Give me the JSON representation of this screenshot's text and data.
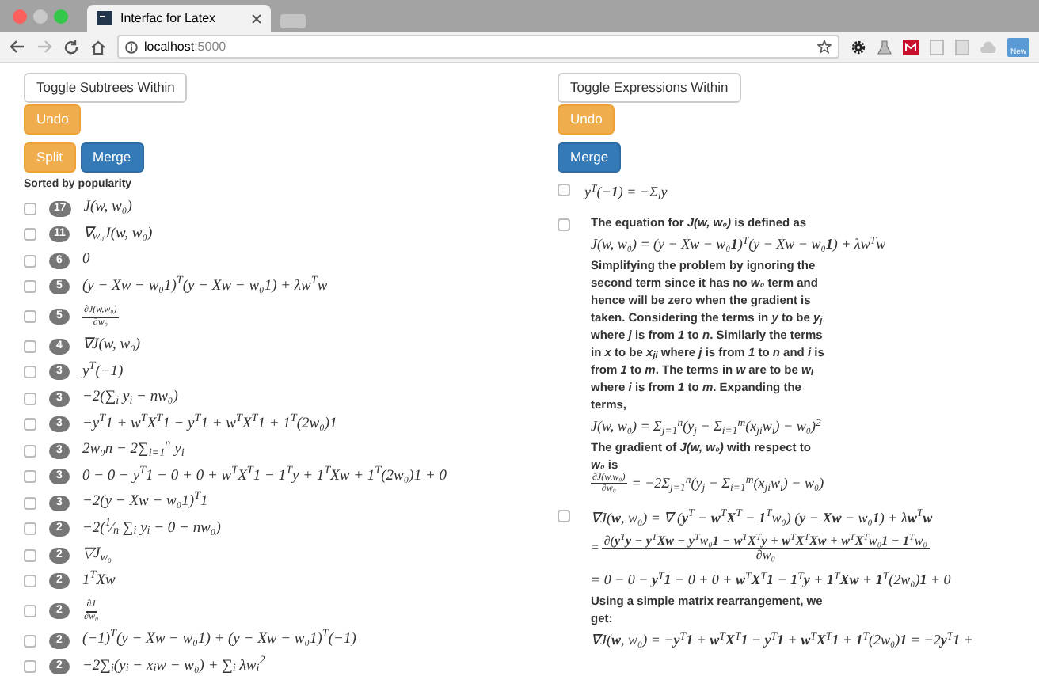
{
  "browser": {
    "tab_title": "Interfac for Latex",
    "url_host": "localhost",
    "url_port": ":5000",
    "extension_badge": "New"
  },
  "left": {
    "buttons": [
      {
        "label": "Toggle Subtrees Within",
        "kind": "default"
      },
      {
        "label": "Undo",
        "kind": "warning"
      },
      {
        "label": "Split",
        "kind": "warning"
      },
      {
        "label": "Merge",
        "kind": "primary"
      }
    ],
    "heading": "Sorted by popularity",
    "items": [
      {
        "checked": false,
        "count": "17",
        "kind": "math",
        "expr": "J(w, w₀)"
      },
      {
        "checked": false,
        "count": "11",
        "kind": "math",
        "expr": "∇$_{w₀}$J(w, w₀)"
      },
      {
        "checked": false,
        "count": "6",
        "kind": "math",
        "expr": "0"
      },
      {
        "checked": false,
        "count": "5",
        "kind": "math",
        "expr": "(y − Xw − w₀1)$^{T}$(y − Xw − w₀1) + λw$^{T}$w"
      },
      {
        "checked": false,
        "count": "5",
        "kind": "fraction",
        "num": "∂J(w,w₀)",
        "den": "∂w₀"
      },
      {
        "checked": false,
        "count": "4",
        "kind": "math",
        "expr": "∇J(w, w₀)"
      },
      {
        "checked": false,
        "count": "3",
        "kind": "math",
        "expr": "y$^{T}$(−1)"
      },
      {
        "checked": false,
        "count": "3",
        "kind": "math",
        "expr": "−2(∑$_{i}$ y$_{i}$ − nw₀)"
      },
      {
        "checked": false,
        "count": "3",
        "kind": "math",
        "expr": "−y$^{T}$1 + w$^{T}$X$^{T}$1 − y$^{T}$1 + w$^{T}$X$^{T}$1 + 1$^{T}$(2w₀)1"
      },
      {
        "checked": false,
        "count": "3",
        "kind": "math",
        "expr": "2w₀n − 2∑$_{i=1}$$^{n}$ y$_{i}$"
      },
      {
        "checked": false,
        "count": "3",
        "kind": "math",
        "expr": "0 − 0 − y$^{T}$1 − 0 + 0 + w$^{T}$X$^{T}$1 − 1$^{T}$y + 1$^{T}$Xw + 1$^{T}$(2w₀)1 + 0"
      },
      {
        "checked": false,
        "count": "3",
        "kind": "math",
        "expr": "−2(y − Xw − w₀1)$^{T}$1"
      },
      {
        "checked": false,
        "count": "2",
        "kind": "math",
        "expr": "−2($^{1}$⁄$_{n}$ ∑$_{i}$ y$_{i}$ − 0 − nw₀)"
      },
      {
        "checked": false,
        "count": "2",
        "kind": "math",
        "expr": "▽J$_{w₀}$"
      },
      {
        "checked": false,
        "count": "2",
        "kind": "math",
        "expr": "1$^{T}$Xw"
      },
      {
        "checked": false,
        "count": "2",
        "kind": "fraction",
        "num": "∂J",
        "den": "∂w₀"
      },
      {
        "checked": false,
        "count": "2",
        "kind": "math",
        "expr": "(−1)$^{T}$(y − Xw − w₀1) + (y − Xw − w₀1)$^{T}$(−1)"
      },
      {
        "checked": false,
        "count": "2",
        "kind": "math",
        "expr": "−2∑$_{i}$(y$_{i}$ − x$_{i}$w − w₀) + ∑$_{i}$ λw$_{i}$$^{2}$"
      }
    ]
  },
  "right": {
    "buttons": [
      {
        "label": "Toggle Expressions Within",
        "kind": "default"
      },
      {
        "label": "Undo",
        "kind": "warning"
      },
      {
        "label": "Merge",
        "kind": "primary"
      }
    ],
    "items": [
      {
        "checked": false,
        "lines": [
          {
            "kind": "math",
            "text": "y$^{T}$(−**1**) = −Σ$_{i}$y"
          }
        ]
      },
      {
        "checked": false,
        "lines": [
          {
            "kind": "text",
            "text": "The equation for *J(w, w₀)* is defined as"
          },
          {
            "kind": "math",
            "text": "J(w, w₀) = (y − Xw − w₀**1**)$^{T}$(y − Xw − w₀**1**) + λw$^{T}$w"
          },
          {
            "kind": "text",
            "text": "Simplifying the problem by ignoring the"
          },
          {
            "kind": "text",
            "text": "second term since it has no *w₀* term and"
          },
          {
            "kind": "text",
            "text": "hence will be zero when the gradient is"
          },
          {
            "kind": "text",
            "text": "taken. Considering the terms in *y* to be *y$_{j}$*"
          },
          {
            "kind": "text",
            "text": "where *j* is from *1* to *n*. Similarly the terms"
          },
          {
            "kind": "text",
            "text": "in *x* to be *x$_{ji}$* where *j* is from *1* to *n* and *i* is"
          },
          {
            "kind": "text",
            "text": "from *1* to *m*. The terms in *w* are to be *w$_{i}$*"
          },
          {
            "kind": "text",
            "text": "where *i* is from *1* to *m*. Expanding the"
          },
          {
            "kind": "text",
            "text": "terms,"
          },
          {
            "kind": "math",
            "text": "J(w, w₀) = Σ$_{j=1}$$^{n}$(y$_{j}$ − Σ$_{i=1}$$^{m}$(x$_{ji}$w$_{i}$) − w₀)$^{2}$"
          },
          {
            "kind": "text",
            "text": "The gradient of *J(w, w₀)* with respect to"
          },
          {
            "kind": "text",
            "text": "*w₀* is"
          },
          {
            "kind": "fraction",
            "num": "∂J(w,w₀)",
            "den": "∂w₀",
            "rest": "= −2Σ$_{j=1}$$^{n}$(y$_{j}$ − Σ$_{i=1}$$^{m}$(x$_{ji}$w$_{i}$) − w₀)"
          }
        ]
      },
      {
        "checked": false,
        "lines": [
          {
            "kind": "math",
            "text": "∇J(**w**, w₀) = ∇ (**y**$^{T}$ − **w**$^{T}$**X**$^{T}$ − **1**$^{T}$w₀) (**y** − **Xw** − w₀**1**) + λ**w**$^{T}$**w**"
          },
          {
            "kind": "bigfraction",
            "lead": "=",
            "num": "∂(**y**$^{T}$**y** − **y**$^{T}$**Xw** − **y**$^{T}$w₀**1** − **w**$^{T}$**X**$^{T}$**y** + **w**$^{T}$**X**$^{T}$**Xw** + **w**$^{T}$**X**$^{T}$w₀**1** − **1**$^{T}$w₀",
            "den": "∂w₀"
          },
          {
            "kind": "math",
            "text": "= 0 − 0 − **y**$^{T}$**1** − 0 + 0 + **w**$^{T}$**X**$^{T}$**1** − **1**$^{T}$**y** + **1**$^{T}$**Xw** + **1**$^{T}$(2w₀)**1** + 0"
          },
          {
            "kind": "text",
            "text": "Using a simple matrix rearrangement, we"
          },
          {
            "kind": "text",
            "text": "get:"
          },
          {
            "kind": "math",
            "text": "∇J(**w**, w₀) = −**y**$^{T}$**1** + **w**$^{T}$**X**$^{T}$**1** − **y**$^{T}$**1** + **w**$^{T}$**X**$^{T}$**1** + **1**$^{T}$(2w₀)**1** = −2**y**$^{T}$**1** +"
          }
        ]
      }
    ]
  }
}
